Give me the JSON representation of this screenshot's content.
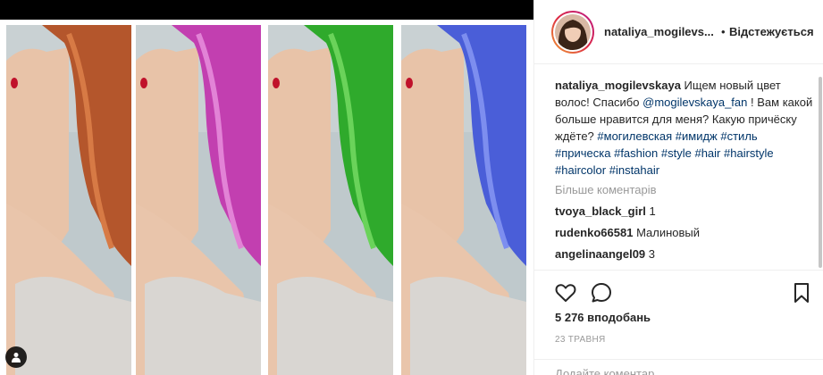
{
  "post": {
    "user_tag_icon": "person-icon",
    "panels": [
      {
        "hair_color": "#b4562c",
        "hair_highlight": "#d77a45"
      },
      {
        "hair_color": "#c23fb0",
        "hair_highlight": "#e283d6"
      },
      {
        "hair_color": "#2faa2c",
        "hair_highlight": "#6ad35a"
      },
      {
        "hair_color": "#4a5ed8",
        "hair_highlight": "#7d8eef"
      }
    ]
  },
  "header": {
    "username": "nataliya_mogilevs...",
    "dot": "•",
    "follow_label": "Відстежується"
  },
  "caption": {
    "username": "nataliya_mogilevskaya",
    "text_1": "Ищем новый цвет волос! Спасибо",
    "mention": "@mogilevskaya_fan",
    "text_2": "! Вам какой больше нравится для меня? Какую причёску ждёте?",
    "hashtags": [
      "#могилевская",
      "#имидж",
      "#стиль",
      "#прическа",
      "#fashion",
      "#style",
      "#hair",
      "#hairstyle",
      "#haircolor",
      "#instahair"
    ]
  },
  "more_comments": "Більше коментарів",
  "comments": [
    {
      "username": "tvoya_black_girl",
      "text": "1"
    },
    {
      "username": "rudenko66581",
      "text": "Малиновый"
    },
    {
      "username": "angelinaangel09",
      "text": "3"
    }
  ],
  "actions": {
    "like_icon": "heart-icon",
    "comment_icon": "comment-icon",
    "save_icon": "bookmark-icon",
    "likes": "5 276 вподобань",
    "date": "23 ТРАВНЯ",
    "add_comment_placeholder": "Додайте коментар..."
  }
}
